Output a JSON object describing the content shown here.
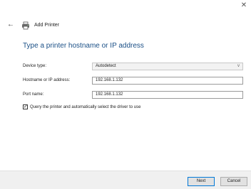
{
  "window": {
    "close_glyph": "✕"
  },
  "header": {
    "back_glyph": "←",
    "title": "Add Printer"
  },
  "main": {
    "heading": "Type a printer hostname or IP address"
  },
  "form": {
    "device_type": {
      "label": "Device type:",
      "value": "Autodetect",
      "chevron": "v"
    },
    "hostname": {
      "label": "Hostname or IP address:",
      "value": "192.168.1.132"
    },
    "port_name": {
      "label": "Port name:",
      "value": "192.168.1.132"
    },
    "query_printer": {
      "label": "Query the printer and automatically select the driver to use",
      "checked": true,
      "check_glyph": "✓"
    }
  },
  "footer": {
    "next_label": "Next",
    "cancel_label": "Cancel"
  },
  "icons": {
    "close": "close-icon",
    "back": "back-arrow-icon",
    "printer": "printer-icon",
    "chevron": "chevron-down-icon",
    "check": "checkmark-icon"
  },
  "colors": {
    "heading": "#1a4f86",
    "primary_button_border": "#0078d7",
    "footer_bg": "#f0f0f0"
  }
}
